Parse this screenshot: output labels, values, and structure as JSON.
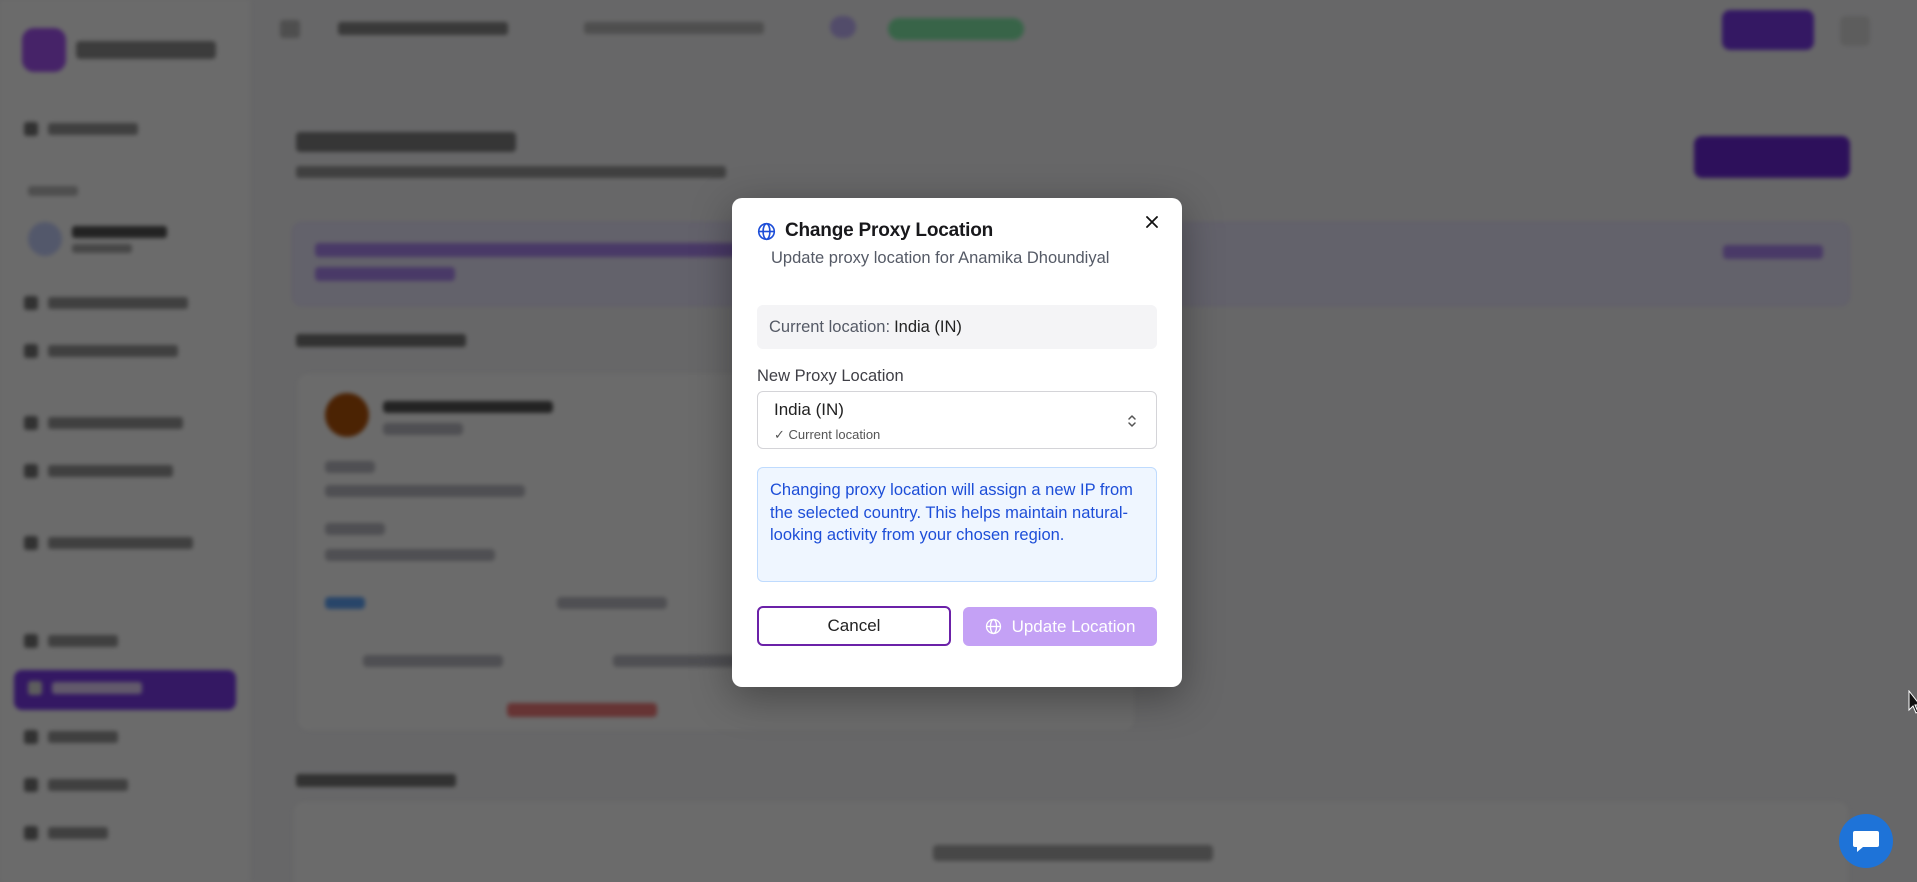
{
  "modal": {
    "title": "Change Proxy Location",
    "subtitle": "Update proxy location for Anamika Dhoundiyal",
    "current_location_label": "Current location:",
    "current_location_value": "India (IN)",
    "field_label": "New Proxy Location",
    "select_value": "India (IN)",
    "select_hint": "✓ Current location",
    "info_text": "Changing proxy location will assign a new IP from the selected country. This helps maintain natural-looking activity from your chosen region.",
    "cancel_label": "Cancel",
    "update_label": "Update Location",
    "icons": {
      "title": "globe-icon",
      "close": "close-icon",
      "select": "chevron-up-down-icon",
      "update": "globe-icon"
    }
  },
  "colors": {
    "accent": "#7c3aed",
    "update_button_disabled": "#c4a1f5",
    "info_text": "#1d4ed8",
    "info_bg": "#eff6ff",
    "chat": "#1e73d8"
  },
  "chat_widget": {
    "icon": "chat-bubble-icon"
  }
}
